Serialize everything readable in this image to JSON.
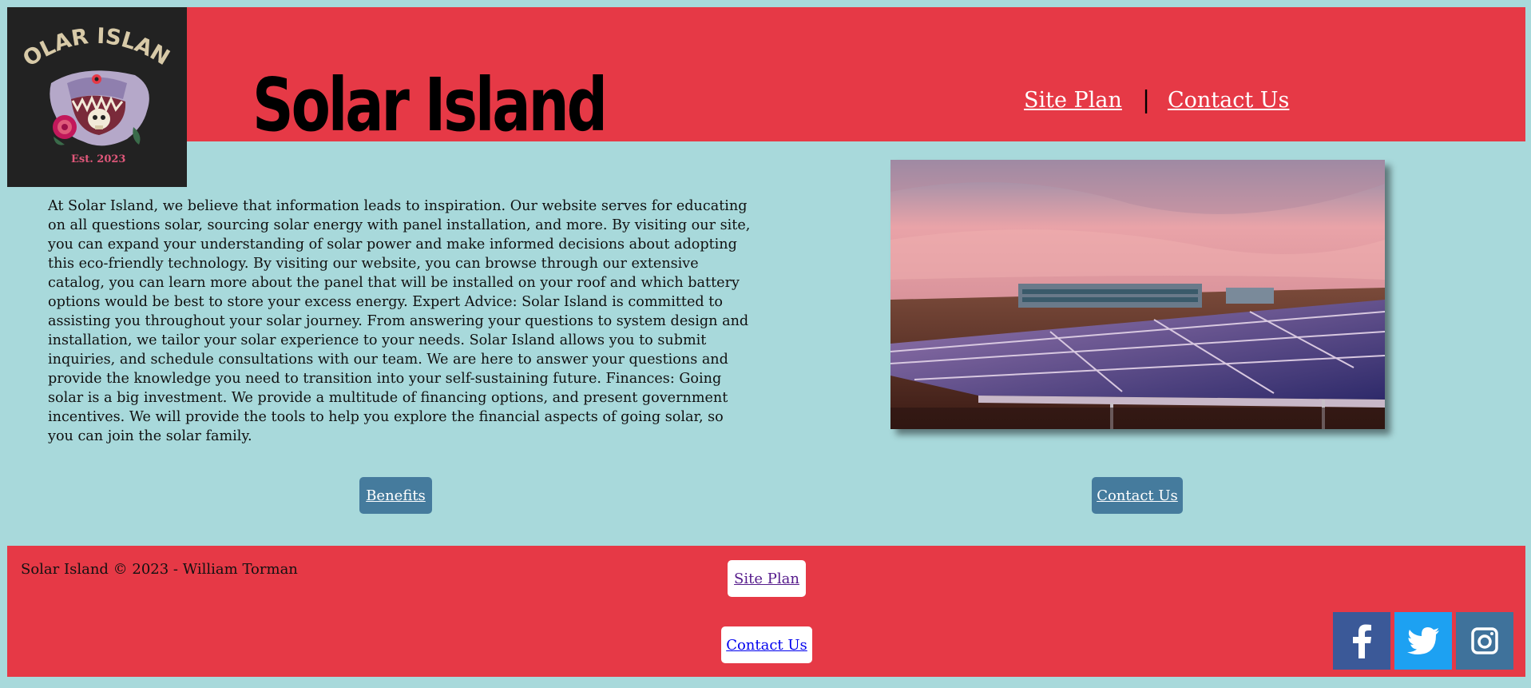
{
  "header": {
    "logo": {
      "arc_text": "SOLAR ISLAND",
      "est_text": "Est. 2023",
      "icon": "shark-skull-rose-logo"
    },
    "title": "Solar Island",
    "nav": [
      {
        "label": "Site Plan"
      },
      {
        "label": "|"
      },
      {
        "label": "Contact Us"
      }
    ]
  },
  "main": {
    "intro": "At Solar Island, we believe that information leads to inspiration. Our website serves for educating on all questions solar, sourcing solar energy with panel installation, and more. By visiting our site, you can expand your understanding of solar power and make informed decisions about adopting this eco-friendly technology. By visiting our website, you can browse through our extensive catalog, you can learn more about the panel that will be installed on your roof and which battery options would be best to store your excess energy. Expert Advice: Solar Island is committed to assisting you throughout your solar journey. From answering your questions to system design and installation, we tailor your solar experience to your needs. Solar Island allows you to submit inquiries, and schedule consultations with our team. We are here to answer your questions and provide the knowledge you need to transition into your self-sustaining future. Finances: Going solar is a big investment. We provide a multitude of financing options, and present government incentives. We will provide the tools to help you explore the financial aspects of going solar, so you can join the solar family.",
    "hero_image": "solar-panels-at-sunset-photo",
    "buttons": {
      "benefits": "Benefits",
      "contact": "Contact Us"
    }
  },
  "footer": {
    "copyright": "Solar Island © 2023 - William Torman",
    "site_plan": "Site Plan",
    "contact": "Contact Us",
    "social": [
      {
        "icon": "facebook-icon",
        "color": "#3b5998"
      },
      {
        "icon": "twitter-icon",
        "color": "#1da1f2"
      },
      {
        "icon": "instagram-icon",
        "color": "#3f729b"
      }
    ]
  },
  "colors": {
    "background": "#a8d9db",
    "header_footer": "#e63946",
    "button_blue": "#457b9d",
    "logo_bg": "#222222"
  }
}
